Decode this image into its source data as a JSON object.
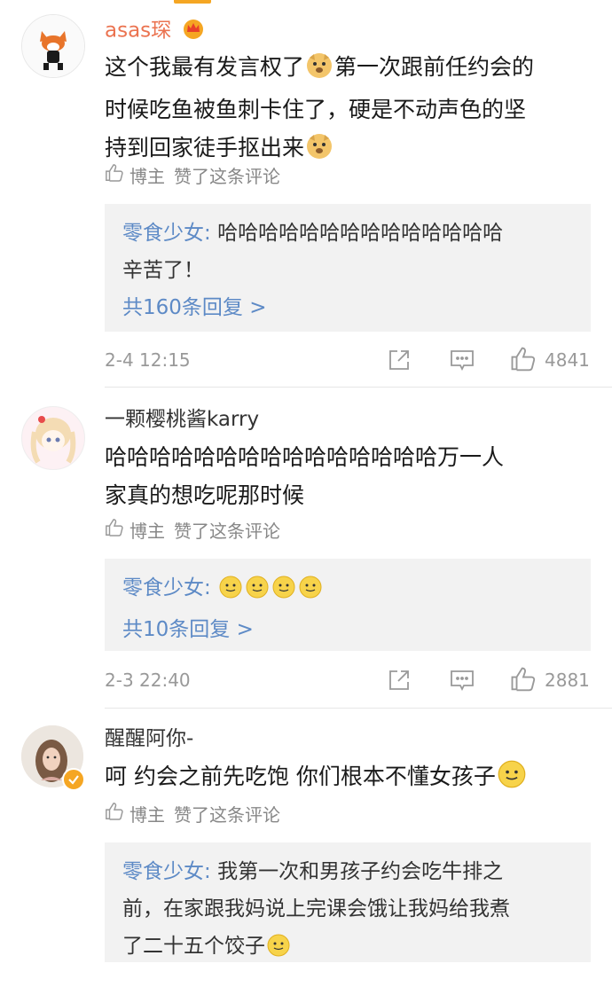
{
  "colors": {
    "vip_name": "#eb7350",
    "link": "#5d8ac6",
    "meta": "#999999",
    "reply_bg": "#f2f2f2"
  },
  "comments": [
    {
      "username": "asas琛",
      "text_lines": [
        "这个我最有发言权了",
        "第一次跟前任约会的",
        "时候吃鱼被鱼刺卡住了，硬是不动声色的坚",
        "持到回家徒手抠出来"
      ],
      "liked_by": "博主",
      "liked_text": "赞了这条评论",
      "reply": {
        "author": "零食少女:",
        "text": "哈哈哈哈哈哈哈哈哈哈哈哈哈哈",
        "text2": "辛苦了！",
        "more": "共160条回复 >"
      },
      "time": "2-4 12:15",
      "likes": "4841"
    },
    {
      "username": "一颗樱桃酱karry",
      "text_lines": [
        "哈哈哈哈哈哈哈哈哈哈哈哈哈哈哈万一人",
        "家真的想吃呢那时候"
      ],
      "liked_by": "博主",
      "liked_text": "赞了这条评论",
      "reply": {
        "author": "零食少女:",
        "text": "",
        "more": "共10条回复 >"
      },
      "time": "2-3 22:40",
      "likes": "2881"
    },
    {
      "username": "醒醒阿你-",
      "text_lines": [
        "呵 约会之前先吃饱 你们根本不懂女孩子"
      ],
      "liked_by": "博主",
      "liked_text": "赞了这条评论",
      "reply": {
        "author": "零食少女:",
        "text": "我第一次和男孩子约会吃牛排之",
        "text2": "前，在家跟我妈说上完课会饿让我妈给我煮",
        "text3": "了二十五个饺子"
      }
    }
  ]
}
